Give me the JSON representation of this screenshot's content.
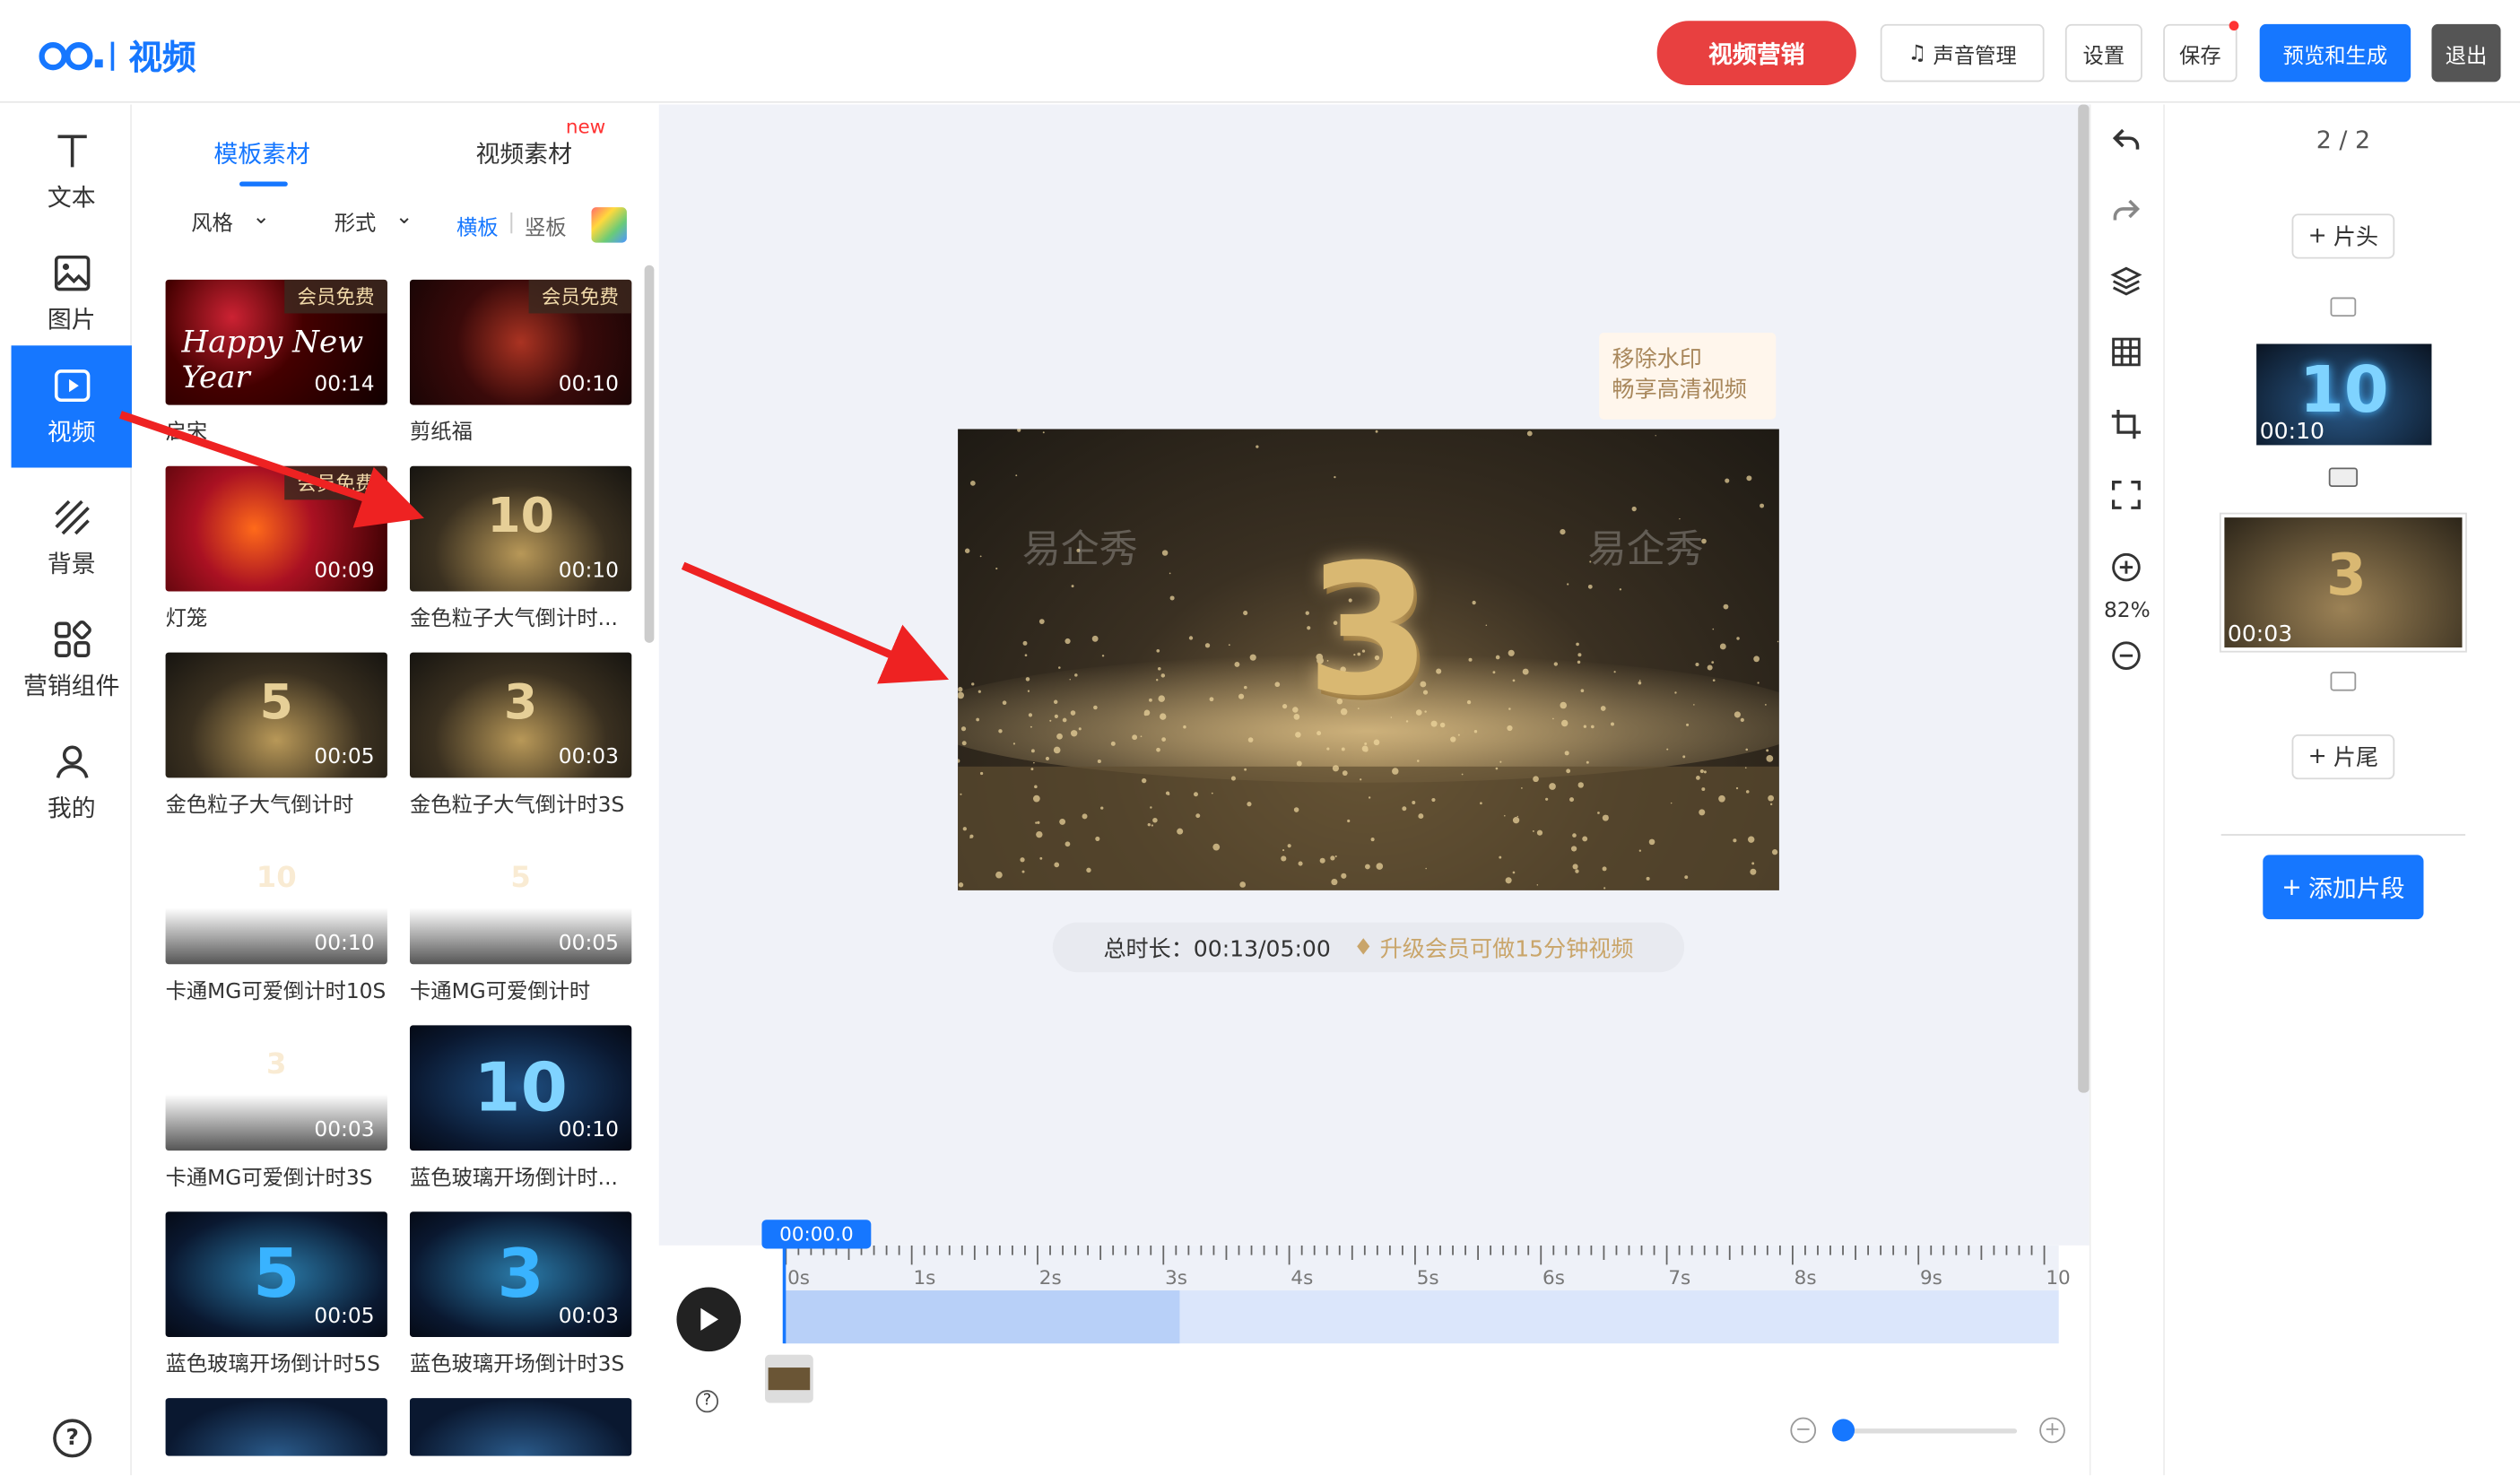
{
  "header": {
    "logo_text": "视频",
    "marketing_button": "视频营销",
    "sound_button": "声音管理",
    "settings_button": "设置",
    "save_button": "保存",
    "preview_button": "预览和生成",
    "exit_button": "退出"
  },
  "sidebar": {
    "items": [
      {
        "label": "文本",
        "icon": "text-icon"
      },
      {
        "label": "图片",
        "icon": "image-icon"
      },
      {
        "label": "视频",
        "icon": "video-icon"
      },
      {
        "label": "背景",
        "icon": "background-icon"
      },
      {
        "label": "营销组件",
        "icon": "widgets-icon"
      },
      {
        "label": "我的",
        "icon": "user-icon"
      }
    ],
    "help_icon": "help-icon"
  },
  "panel": {
    "tabs": [
      "模板素材",
      "视频素材"
    ],
    "new_badge": "new",
    "filters": {
      "style": "风格",
      "form": "形式",
      "horizontal": "横板",
      "vertical": "竖板"
    },
    "templates": [
      {
        "title": "启宋",
        "duration": "00:14",
        "badge": "会员免费"
      },
      {
        "title": "剪纸福",
        "duration": "00:10",
        "badge": "会员免费"
      },
      {
        "title": "灯笼",
        "duration": "00:09",
        "badge": "会员免费"
      },
      {
        "title": "金色粒子大气倒计时...",
        "duration": "00:10",
        "badge": ""
      },
      {
        "title": "金色粒子大气倒计时",
        "duration": "00:05",
        "badge": ""
      },
      {
        "title": "金色粒子大气倒计时3S",
        "duration": "00:03",
        "badge": ""
      },
      {
        "title": "卡通MG可爱倒计时10S",
        "duration": "00:10",
        "badge": ""
      },
      {
        "title": "卡通MG可爱倒计时",
        "duration": "00:05",
        "badge": ""
      },
      {
        "title": "卡通MG可爱倒计时3S",
        "duration": "00:03",
        "badge": ""
      },
      {
        "title": "蓝色玻璃开场倒计时...",
        "duration": "00:10",
        "badge": ""
      },
      {
        "title": "蓝色玻璃开场倒计时5S",
        "duration": "00:05",
        "badge": ""
      },
      {
        "title": "蓝色玻璃开场倒计时3S",
        "duration": "00:03",
        "badge": ""
      }
    ]
  },
  "canvas": {
    "watermark_line1": "移除水印",
    "watermark_line2": "畅享高清视频",
    "number": "3",
    "wm_text": "易企秀",
    "total_label": "总时长：00:13/05:00",
    "upgrade_text": "升级会员可做15分钟视频"
  },
  "tools": {
    "zoom": "82%"
  },
  "right": {
    "page_indicator": "2 / 2",
    "add_head": "片头",
    "add_tail": "片尾",
    "clips": [
      {
        "duration": "00:10",
        "number": "10"
      },
      {
        "duration": "00:03",
        "number": "3"
      }
    ],
    "add_segment": "添加片段"
  },
  "timeline": {
    "current_time": "00:00.0",
    "ticks": [
      "0s",
      "1s",
      "2s",
      "3s",
      "4s",
      "5s",
      "6s",
      "7s",
      "8s",
      "9s",
      "10"
    ],
    "progress": 0.31
  },
  "colors": {
    "accent": "#1677ff",
    "marketing": "#e84040",
    "gold": "#c9a56a"
  }
}
